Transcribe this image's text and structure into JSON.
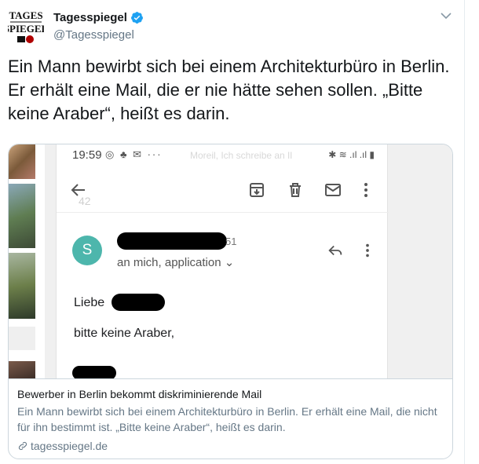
{
  "tweet": {
    "author": {
      "display_name": "Tagesspiegel",
      "handle": "@Tagesspiegel",
      "logo_lines": [
        "TAGES",
        "SPIEGEL"
      ]
    },
    "text": "Ein Mann bewirbt sich bei einem Architekturbüro in Berlin. Er erhält eine Mail, die er nie hätte sehen sollen. „Bitte keine Araber“, heißt es darin."
  },
  "card": {
    "image": {
      "status_time": "19:59",
      "status_icons_left": "◎ ♣ ✉ ···",
      "status_icons_right": "✱ ≋ .ıl .ıl ▮",
      "faded_snippet": "Moreil, Ich schreibe an Il",
      "faded_number": "42",
      "avatar_letter": "S",
      "sender_suffix": "51",
      "recipients": "an mich, application ⌄",
      "greeting": "Liebe",
      "body_line": "bitte keine Araber,"
    },
    "title": "Bewerber in Berlin bekommt diskriminierende Mail",
    "description": "Ein Mann bewirbt sich bei einem Architekturbüro in Berlin. Er erhält eine Mail, die nicht für ihn bestimmt ist. „Bitte keine Araber“, heißt es darin.",
    "domain": "tagesspiegel.de"
  },
  "colors": {
    "verified": "#1da1f2",
    "secondary_text": "#657786",
    "avatar": "#4db6ac",
    "border": "#ccd6dd"
  }
}
